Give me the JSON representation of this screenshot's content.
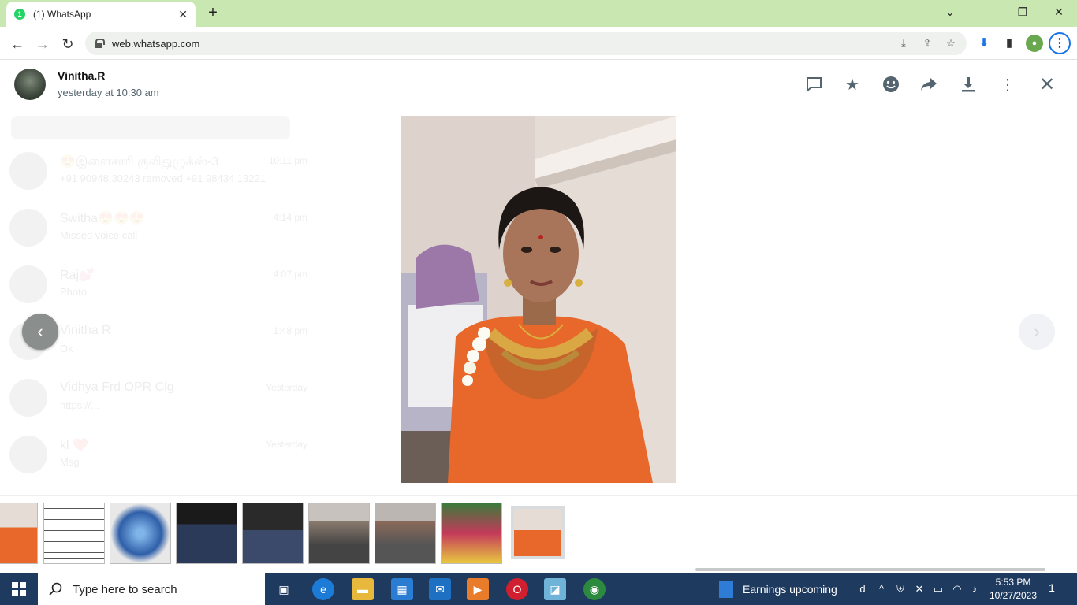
{
  "browser": {
    "tab_title": "(1) WhatsApp",
    "tab_badge": "1",
    "tab_close": "✕",
    "new_tab": "+",
    "url": "web.whatsapp.com",
    "window_controls": [
      "⌄",
      "—",
      "❐",
      "✕"
    ]
  },
  "viewer": {
    "sender_name": "Vinitha.R",
    "timestamp": "yesterday at 10:30 am",
    "header_icons": [
      "reply-icon",
      "star-icon",
      "emoji-icon",
      "forward-icon",
      "download-icon",
      "menu-icon",
      "close-icon"
    ],
    "prev_glyph": "‹",
    "next_glyph": "›",
    "thumbnail_count": 9,
    "active_thumbnail_index": 8
  },
  "background_chats": [
    {
      "name": "😍இளைசாரி குலிதுழுக்ஸ்-3",
      "time": "10:11 pm",
      "message": "+91 90948 30243 removed +91 98434 13221"
    },
    {
      "name": "Switha😍😍😍",
      "time": "4:14 pm",
      "message": "Missed voice call"
    },
    {
      "name": "Raj💕",
      "time": "4:07 pm",
      "message": "Photo"
    },
    {
      "name": "Vinitha R",
      "time": "1:48 pm",
      "message": "Ok"
    },
    {
      "name": "Vidhya Frd OPR Clg",
      "time": "Yesterday",
      "message": "https://..."
    },
    {
      "name": "kl ❤️",
      "time": "Yesterday",
      "message": "Msg"
    }
  ],
  "taskbar": {
    "search_placeholder": "Type here to search",
    "weather_text": "Earnings upcoming",
    "time": "5:53 PM",
    "date": "10/27/2023",
    "notification_count": "1"
  },
  "colors": {
    "tab_strip": "#c9e7b0",
    "taskbar": "#1f3a5f",
    "whatsapp_green": "#25d366",
    "icon_gray": "#54656f"
  }
}
